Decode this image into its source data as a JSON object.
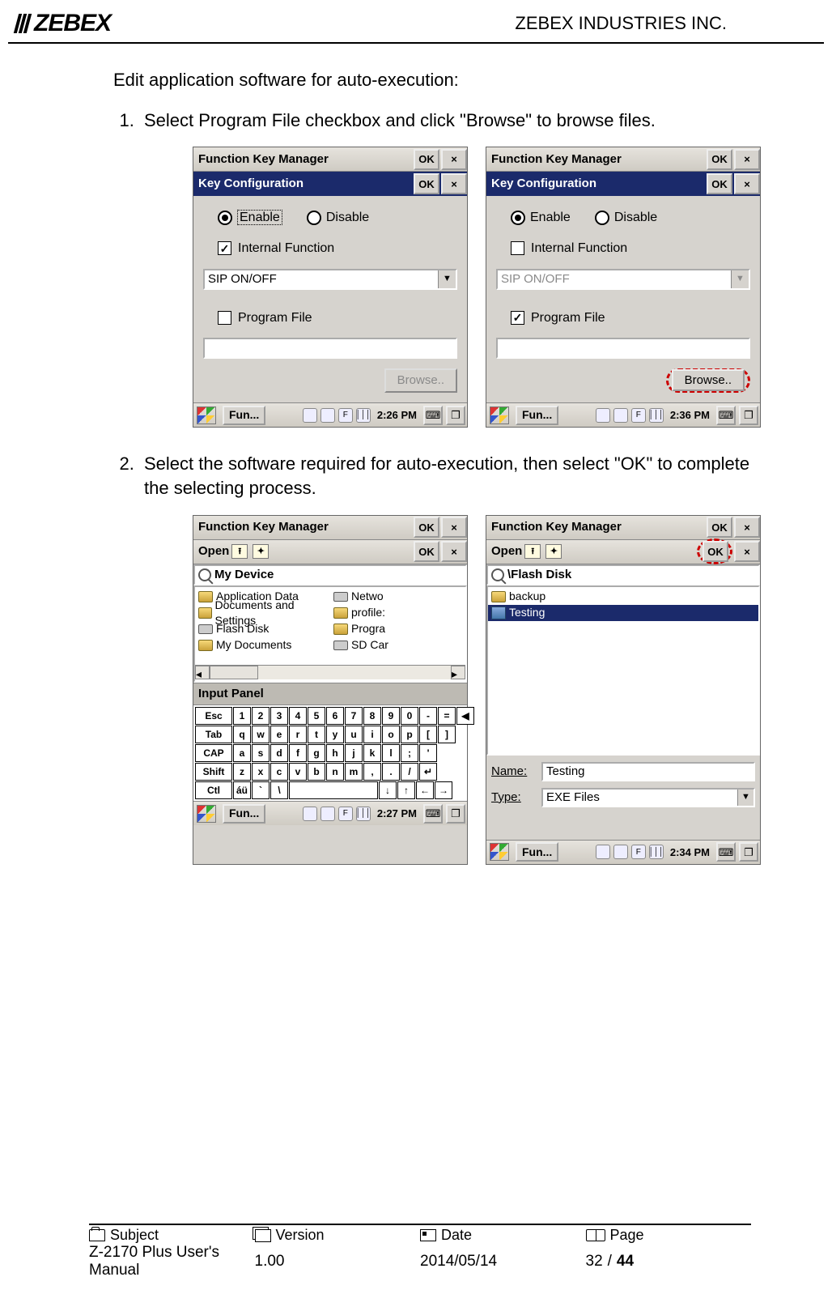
{
  "header": {
    "brand": "ZEBEX",
    "company": "ZEBEX INDUSTRIES INC."
  },
  "intro": "Edit application software for auto-execution:",
  "step1": "Select Program File checkbox and click \"Browse\" to browse files.",
  "step2": "Select the software required for auto-execution, then select \"OK\" to complete the selecting process.",
  "win": {
    "fkm_title": "Function Key Manager",
    "ok": "OK",
    "close": "×",
    "key_config": "Key Configuration",
    "enable": "Enable",
    "disable": "Disable",
    "internal_function": "Internal Function",
    "sip": "SIP ON/OFF",
    "program_file": "Program File",
    "browse": "Browse..",
    "open": "Open",
    "my_device": "My Device",
    "flash_disk_path": "\\Flash Disk",
    "name_lbl": "Name:",
    "type_lbl": "Type:",
    "exe_files": "EXE Files",
    "testing": "Testing",
    "input_panel": "Input Panel",
    "task_app": "Fun...",
    "clock1": "2:26 PM",
    "clock2": "2:36 PM",
    "clock3": "2:27 PM",
    "clock4": "2:34 PM"
  },
  "files": {
    "left": [
      "Application Data",
      "Documents and Settings",
      "Flash Disk",
      "My Documents",
      "Netwo",
      "profile:",
      "Progra",
      "SD Car"
    ],
    "right": [
      "backup",
      "Testing"
    ]
  },
  "kbd": {
    "r1": [
      "Esc",
      "1",
      "2",
      "3",
      "4",
      "5",
      "6",
      "7",
      "8",
      "9",
      "0",
      "-",
      "=",
      "◀"
    ],
    "r2": [
      "Tab",
      "q",
      "w",
      "e",
      "r",
      "t",
      "y",
      "u",
      "i",
      "o",
      "p",
      "[",
      "]"
    ],
    "r3": [
      "CAP",
      "a",
      "s",
      "d",
      "f",
      "g",
      "h",
      "j",
      "k",
      "l",
      ";",
      "'"
    ],
    "r4": [
      "Shift",
      "z",
      "x",
      "c",
      "v",
      "b",
      "n",
      "m",
      ",",
      ".",
      "/",
      "↵"
    ],
    "r5": [
      "Ctl",
      "áü",
      "`",
      "\\",
      " ",
      "↓",
      "↑",
      "←",
      "→"
    ]
  },
  "footer": {
    "subject_lbl": "Subject",
    "subject": "Z-2170 Plus User's Manual",
    "version_lbl": "Version",
    "version": "1.00",
    "date_lbl": "Date",
    "date": "2014/05/14",
    "page_lbl": "Page",
    "page_cur": "32",
    "page_sep": " / ",
    "page_tot": "44"
  }
}
